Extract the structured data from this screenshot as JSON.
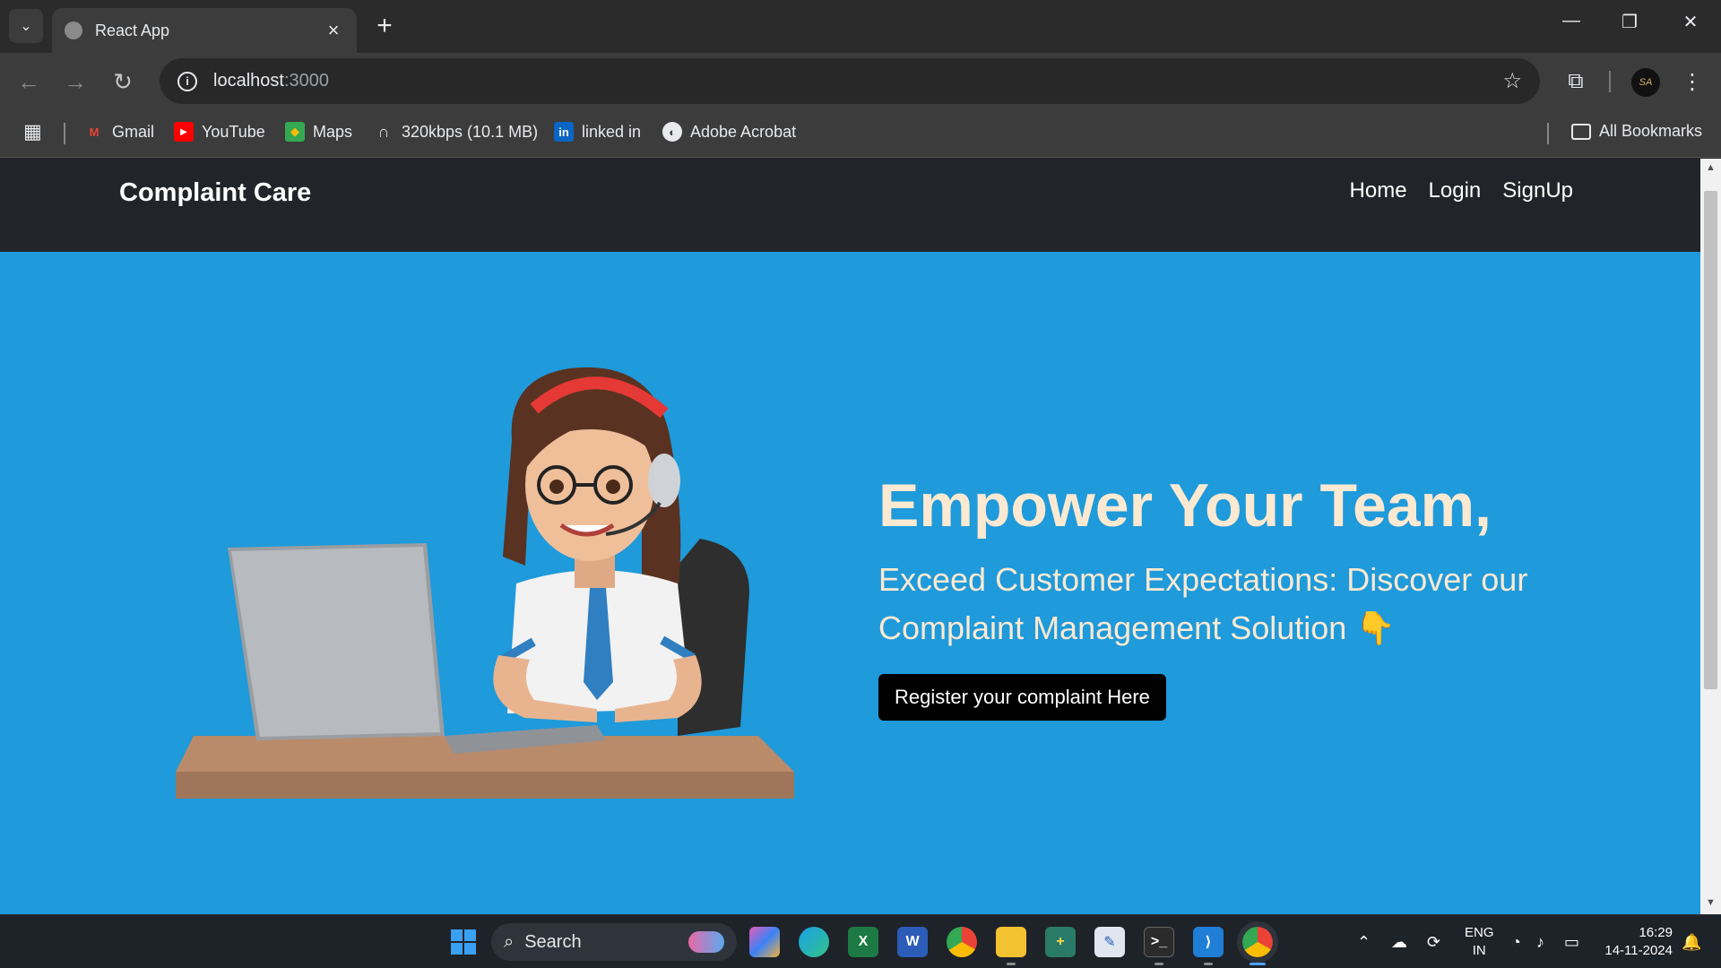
{
  "browser": {
    "tab_title": "React App",
    "tab_close": "×",
    "new_tab": "+",
    "address_host": "localhost",
    "address_port": ":3000"
  },
  "bookmarks": [
    {
      "label": "Gmail",
      "icon": "gmail-icon"
    },
    {
      "label": "YouTube",
      "icon": "youtube-icon"
    },
    {
      "label": "Maps",
      "icon": "maps-icon"
    },
    {
      "label": "320kbps (10.1 MB)",
      "icon": "headphones-icon"
    },
    {
      "label": "linked in",
      "icon": "linkedin-icon"
    },
    {
      "label": "Adobe Acrobat",
      "icon": "globe-icon"
    }
  ],
  "all_bookmarks": "All Bookmarks",
  "profile_initials": "SA",
  "app": {
    "brand": "Complaint Care",
    "nav": {
      "home": "Home",
      "login": "Login",
      "signup": "SignUp"
    },
    "hero": {
      "title": "Empower Your Team,",
      "subtitle": "Exceed Customer Expectations: Discover our Complaint Management Solution 👇",
      "cta": "Register your complaint Here"
    }
  },
  "taskbar": {
    "search_label": "Search",
    "lang_top": "ENG",
    "lang_bottom": "IN",
    "time": "16:29",
    "date": "14-11-2024"
  },
  "colors": {
    "hero_bg": "#1f9ada",
    "navbar_bg": "#212529",
    "hero_text": "#fbe9d2",
    "cta_bg": "#000000"
  }
}
